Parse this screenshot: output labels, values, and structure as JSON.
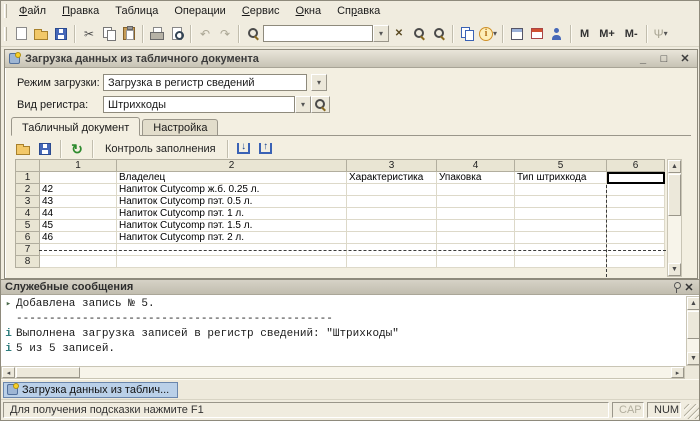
{
  "ui": {
    "dropdown": "▾",
    "up": "▲",
    "down": "▼",
    "left": "◂",
    "right": "▸"
  },
  "menubar": {
    "items": [
      {
        "pre": "",
        "key": "Ф",
        "post": "айл"
      },
      {
        "pre": "",
        "key": "П",
        "post": "равка"
      },
      {
        "pre": "Таблица",
        "key": "",
        "post": ""
      },
      {
        "pre": "Операции",
        "key": "",
        "post": ""
      },
      {
        "pre": "",
        "key": "С",
        "post": "ервис"
      },
      {
        "pre": "",
        "key": "О",
        "post": "кна"
      },
      {
        "pre": "Сп",
        "key": "р",
        "post": "авка"
      }
    ]
  },
  "toolbar": {
    "search_value": "",
    "buttons": [
      {
        "name": "new-document",
        "glyph": ""
      },
      {
        "name": "open",
        "glyph": ""
      },
      {
        "name": "save",
        "glyph": ""
      },
      {
        "name": "cut",
        "glyph": "✂"
      },
      {
        "name": "copy",
        "glyph": ""
      },
      {
        "name": "paste",
        "glyph": ""
      },
      {
        "name": "print",
        "glyph": ""
      },
      {
        "name": "print-preview",
        "glyph": ""
      },
      {
        "name": "back",
        "glyph": "↶"
      },
      {
        "name": "forward",
        "glyph": "↷"
      },
      {
        "name": "find",
        "glyph": ""
      },
      {
        "name": "search-dropdown",
        "glyph": "▾"
      },
      {
        "name": "search-clear",
        "glyph": "✕"
      },
      {
        "name": "zoom-in",
        "glyph": ""
      },
      {
        "name": "zoom-out",
        "glyph": ""
      },
      {
        "name": "clipboard-buffer",
        "glyph": ""
      },
      {
        "name": "info",
        "glyph": "i"
      },
      {
        "name": "info-dropdown",
        "glyph": "▾"
      },
      {
        "name": "calculator",
        "glyph": ""
      },
      {
        "name": "calendar",
        "glyph": ""
      },
      {
        "name": "users",
        "glyph": ""
      },
      {
        "name": "memory",
        "glyph": "M"
      },
      {
        "name": "memory-plus",
        "glyph": "M+"
      },
      {
        "name": "memory-minus",
        "glyph": "M-"
      },
      {
        "name": "tools",
        "glyph": "Ψ"
      },
      {
        "name": "tools-dropdown",
        "glyph": "▾"
      }
    ]
  },
  "window": {
    "title": "Загрузка данных из табличного документа",
    "controls": {
      "minimize": "_",
      "maximize": "□",
      "close": "✕"
    },
    "fields": {
      "load_mode_label": "Режим загрузки:",
      "load_mode_value": "Загрузка в регистр сведений",
      "register_label": "Вид регистра:",
      "register_value": "Штрихкоды"
    },
    "tabs": [
      {
        "label": "Табличный документ"
      },
      {
        "label": "Настройка"
      }
    ],
    "tab_toolbar": {
      "refresh_glyph": "↻",
      "control_label": "Контроль заполнения",
      "import_glyph": "↓",
      "export_glyph": "↑"
    },
    "table": {
      "col_headers": [
        "1",
        "2",
        "3",
        "4",
        "5",
        "6"
      ],
      "row_headers": [
        "1",
        "2",
        "3",
        "4",
        "5",
        "6",
        "7",
        "8"
      ],
      "rows": [
        [
          "",
          "Владелец",
          "Характеристика",
          "Упаковка",
          "Тип штрихкода",
          ""
        ],
        [
          "42",
          "Напиток Cutycomp ж.б. 0.25 л.",
          "",
          "",
          "",
          ""
        ],
        [
          "43",
          "Напиток Cutycomp пэт. 0.5 л.",
          "",
          "",
          "",
          ""
        ],
        [
          "44",
          "Напиток Cutycomp пэт. 1 л.",
          "",
          "",
          "",
          ""
        ],
        [
          "45",
          "Напиток Cutycomp пэт. 1.5 л.",
          "",
          "",
          "",
          ""
        ],
        [
          "46",
          "Напиток Cutycomp пэт. 2 л.",
          "",
          "",
          "",
          ""
        ],
        [
          "",
          "",
          "",
          "",
          "",
          ""
        ],
        [
          "",
          "",
          "",
          "",
          "",
          ""
        ]
      ]
    }
  },
  "messages": {
    "title": "Служебные сообщения",
    "close_glyph": "✕",
    "lines": [
      {
        "marker": "▸",
        "text": "Добавлена запись № 5."
      },
      {
        "marker": "",
        "text": "------------------------------------------------"
      },
      {
        "marker": "i",
        "text": "Выполнена загрузка записей в регистр сведений: \"Штрихкоды\""
      },
      {
        "marker": "i",
        "text": "5 из 5 записей."
      }
    ]
  },
  "taskbar": {
    "window_button": "Загрузка данных из таблич..."
  },
  "statusbar": {
    "hint": "Для получения подсказки нажмите F1",
    "cap": "CAP",
    "num": "NUM"
  }
}
